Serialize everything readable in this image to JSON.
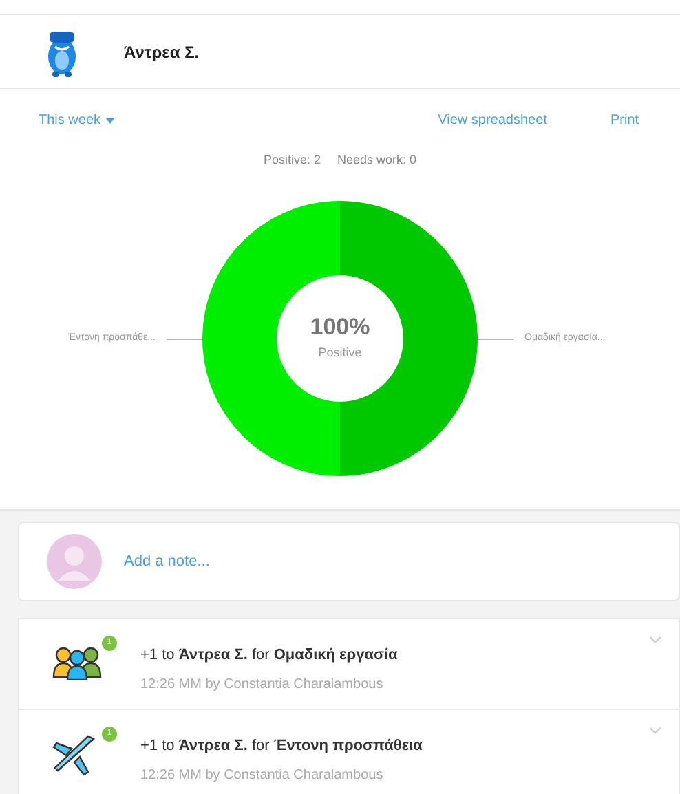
{
  "student": {
    "name": "Άντρεα Σ."
  },
  "toolbar": {
    "period": "This week",
    "view_link": "View spreadsheet",
    "print_link": "Print"
  },
  "summary": {
    "positive_label": "Positive:",
    "positive_count": "2",
    "needs_work_label": "Needs work:",
    "needs_work_count": "0"
  },
  "chart": {
    "center_value": "100%",
    "center_label": "Positive",
    "chart_data": {
      "type": "donut",
      "categories": [
        "Ομαδική εργασία...",
        "Έντονη προσπάθε..."
      ],
      "series": [
        {
          "values": [
            50,
            50
          ]
        }
      ],
      "colors": [
        "#00c800",
        "#00ee00"
      ]
    }
  },
  "note": {
    "placeholder": "Add a note..."
  },
  "feed": [
    {
      "kind": "team",
      "badge": "1",
      "text": "+1 to **Άντρεα Σ.** for **Ομαδική εργασία**",
      "meta": "12:26 MM by Constantia Charalambous"
    },
    {
      "kind": "plane",
      "badge": "1",
      "text": "+1 to **Άντρεα Σ.** for **Έντονη προσπάθεια**",
      "meta": "12:26 MM by Constantia Charalambous"
    }
  ]
}
